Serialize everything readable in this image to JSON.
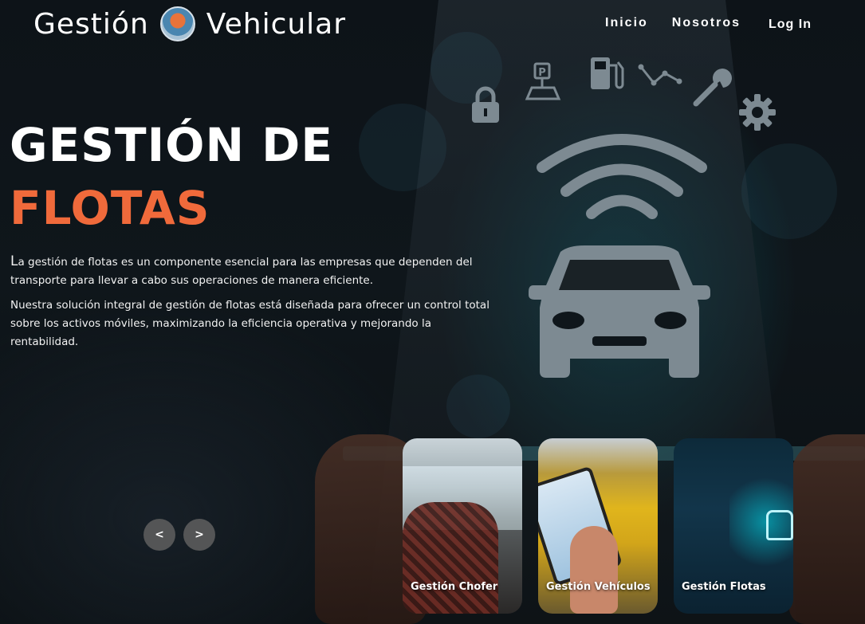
{
  "header": {
    "brand_left": "Gestión",
    "brand_right": "Vehicular",
    "nav": [
      "Inicio",
      "Nosotros"
    ],
    "login_label": "Log In"
  },
  "hero": {
    "title_line1": "GESTIÓN DE",
    "title_line2": "FLOTAS",
    "paragraph1_first": "L",
    "paragraph1_rest": "a gestión de flotas es un componente esencial para las empresas que dependen del transporte para llevar a cabo sus operaciones de manera eficiente.",
    "paragraph2": "Nuestra solución integral de gestión de flotas está diseñada para ofrecer un control total sobre los activos móviles, maximizando la eficiencia operativa y mejorando la rentabilidad."
  },
  "carousel": {
    "prev_label": "<",
    "next_label": ">",
    "cards": [
      "Gestión Chofer",
      "Gestión Vehículos",
      "Gestión Flotas"
    ]
  },
  "colors": {
    "accent": "#f06a3b",
    "background": "#0f161b",
    "glow": "#00aabe"
  },
  "icons": [
    "lock-icon",
    "parking-icon",
    "fuel-icon",
    "route-icon",
    "wrench-icon",
    "gear-icon",
    "wifi-icon",
    "car-icon"
  ]
}
